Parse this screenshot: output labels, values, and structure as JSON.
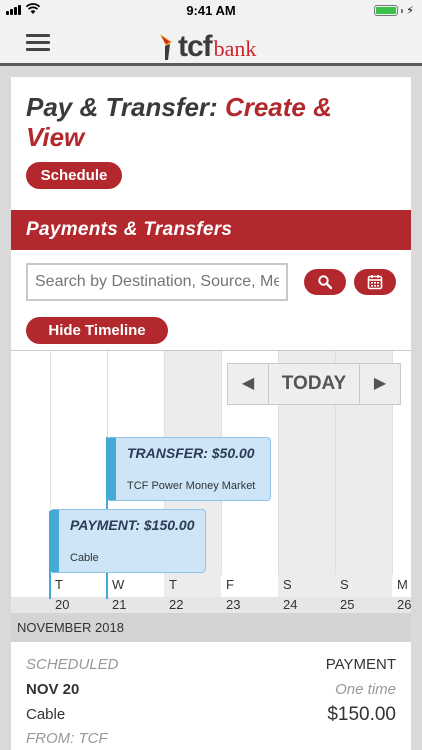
{
  "status_bar": {
    "time": "9:41 AM",
    "charge_symbol": "⚡",
    "battery_level": 1.0
  },
  "header": {
    "logo_text": "tcf",
    "logo_suffix": "bank"
  },
  "page": {
    "title_prefix": "Pay & Transfer: ",
    "title_highlight": "Create & View",
    "schedule_label": "Schedule",
    "section_title": "Payments & Transfers"
  },
  "search": {
    "placeholder": "Search by Destination, Source, Memo"
  },
  "timeline": {
    "hide_label": "Hide Timeline",
    "nav": {
      "prev": "◀",
      "today": "TODAY",
      "next": "▶"
    },
    "days": [
      {
        "letter": "T",
        "num": "20"
      },
      {
        "letter": "W",
        "num": "21"
      },
      {
        "letter": "T",
        "num": "22"
      },
      {
        "letter": "F",
        "num": "23"
      },
      {
        "letter": "S",
        "num": "24"
      },
      {
        "letter": "S",
        "num": "25"
      },
      {
        "letter": "M",
        "num": "26"
      }
    ],
    "month": "NOVEMBER 2018",
    "events": [
      {
        "title": "TRANSFER: $50.00",
        "subtitle": "TCF Power Money Market"
      },
      {
        "title": "PAYMENT: $150.00",
        "subtitle": "Cable"
      }
    ]
  },
  "transaction": {
    "status": "SCHEDULED",
    "type": "PAYMENT",
    "date": "NOV 20",
    "frequency": "One time",
    "payee": "Cable",
    "amount": "$150.00",
    "from": "FROM: TCF"
  },
  "colors": {
    "brand_red": "#b3282d",
    "event_blue": "#44a9d6",
    "event_fill": "#cde5f6"
  },
  "icons": [
    "signal-icon",
    "wifi-icon",
    "battery-icon",
    "hamburger-icon",
    "tcf-logo",
    "search-icon",
    "calendar-icon",
    "chevron-left-icon",
    "chevron-right-icon"
  ]
}
